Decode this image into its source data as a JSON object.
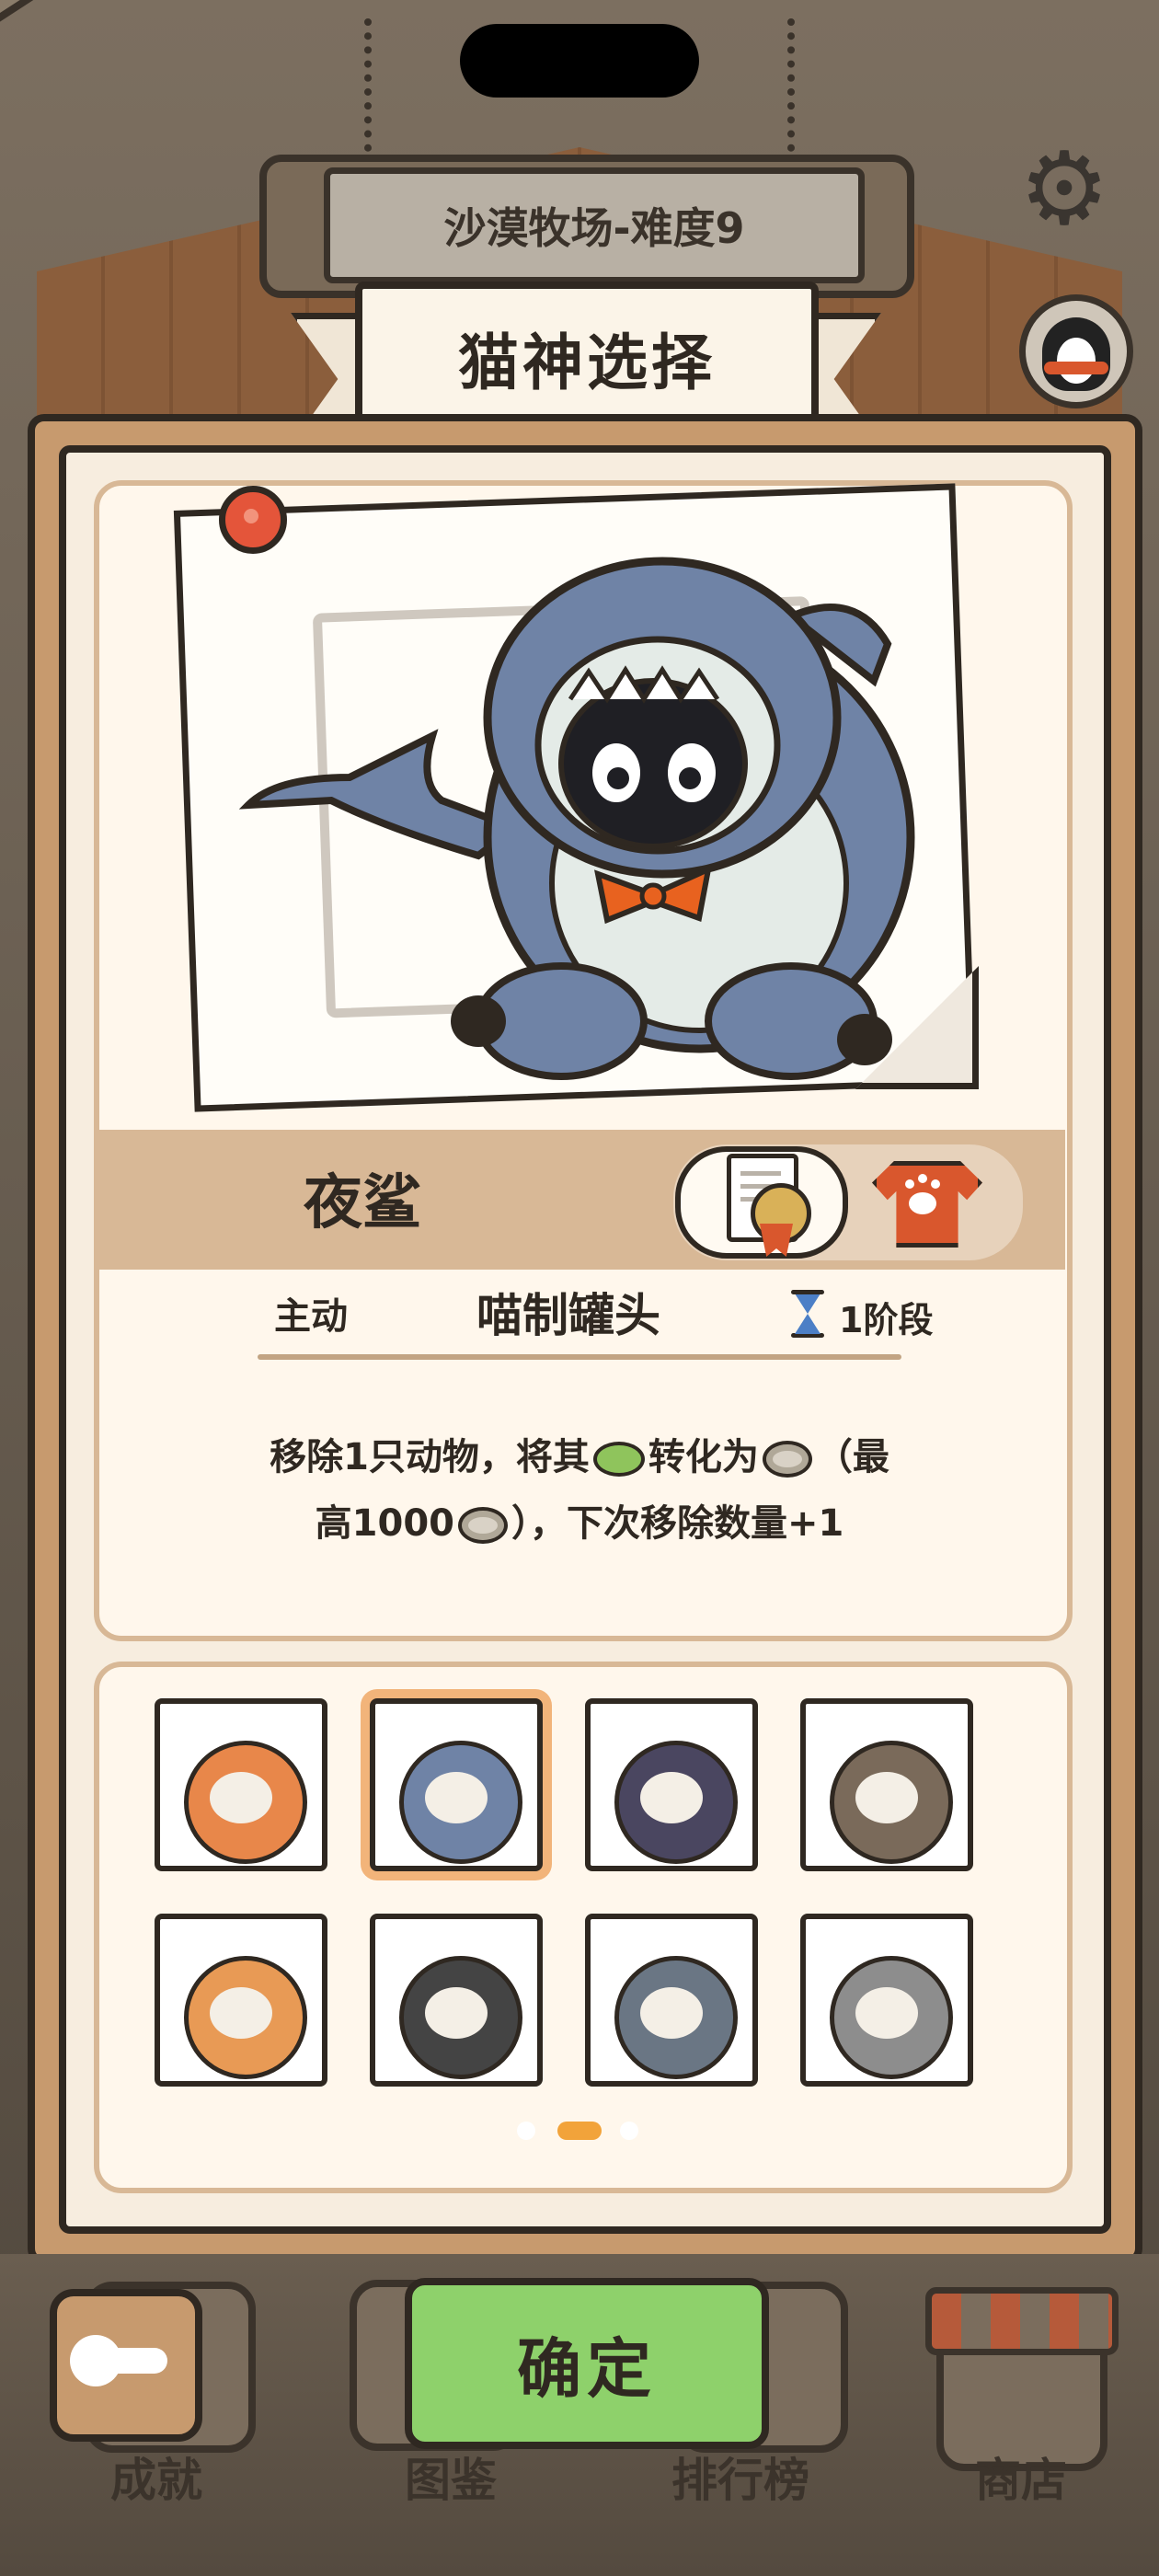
{
  "header": {
    "stage_title": "沙漠牧场-难度9",
    "ribbon_title": "猫神选择"
  },
  "icons": {
    "settings": "gear-icon",
    "profile": "penguin-avatar-icon",
    "pin": "pushpin-icon",
    "certificate": "certificate-icon",
    "outfit": "shirt-icon",
    "duration": "hourglass-icon",
    "back": "back-arrow-icon"
  },
  "cat": {
    "name": "夜鲨",
    "skill_type": "主动",
    "skill_name": "喵制罐头",
    "stage": "1阶段",
    "desc_line1_a": "移除1只动物，将其",
    "desc_line1_b": "转化为",
    "desc_line1_c": "（最",
    "desc_line2_a": "高1000",
    "desc_line2_b": "），下次移除数量+1",
    "desc_icon_frog": "frog-icon",
    "desc_icon_can": "can-icon"
  },
  "grid": {
    "selected_index": 1,
    "page_count": 3,
    "active_page": 1,
    "cells": [
      {
        "icon": "calico-cat-icon",
        "accent": "#e8874a"
      },
      {
        "icon": "shark-cat-icon",
        "accent": "#6f83a6"
      },
      {
        "icon": "wizard-cat-icon",
        "accent": "#4a4660"
      },
      {
        "icon": "siamese-cat-icon",
        "accent": "#7a6a5a"
      },
      {
        "icon": "bread-cat-icon",
        "accent": "#e89a55"
      },
      {
        "icon": "sunglasses-cat-icon",
        "accent": "#444444"
      },
      {
        "icon": "seal-cat-icon",
        "accent": "#6a7684"
      },
      {
        "icon": "tabby-cat-icon",
        "accent": "#8d8d8d"
      }
    ]
  },
  "nav": {
    "achievements": "成就",
    "collection": "图鉴",
    "leaderboard": "排行榜",
    "shop": "商店",
    "confirm": "确定"
  },
  "colors": {
    "confirm": "#8ed16b",
    "panel": "#c79a6e",
    "accent_orange": "#d9572d",
    "page_dot_active": "#f2a33a"
  }
}
